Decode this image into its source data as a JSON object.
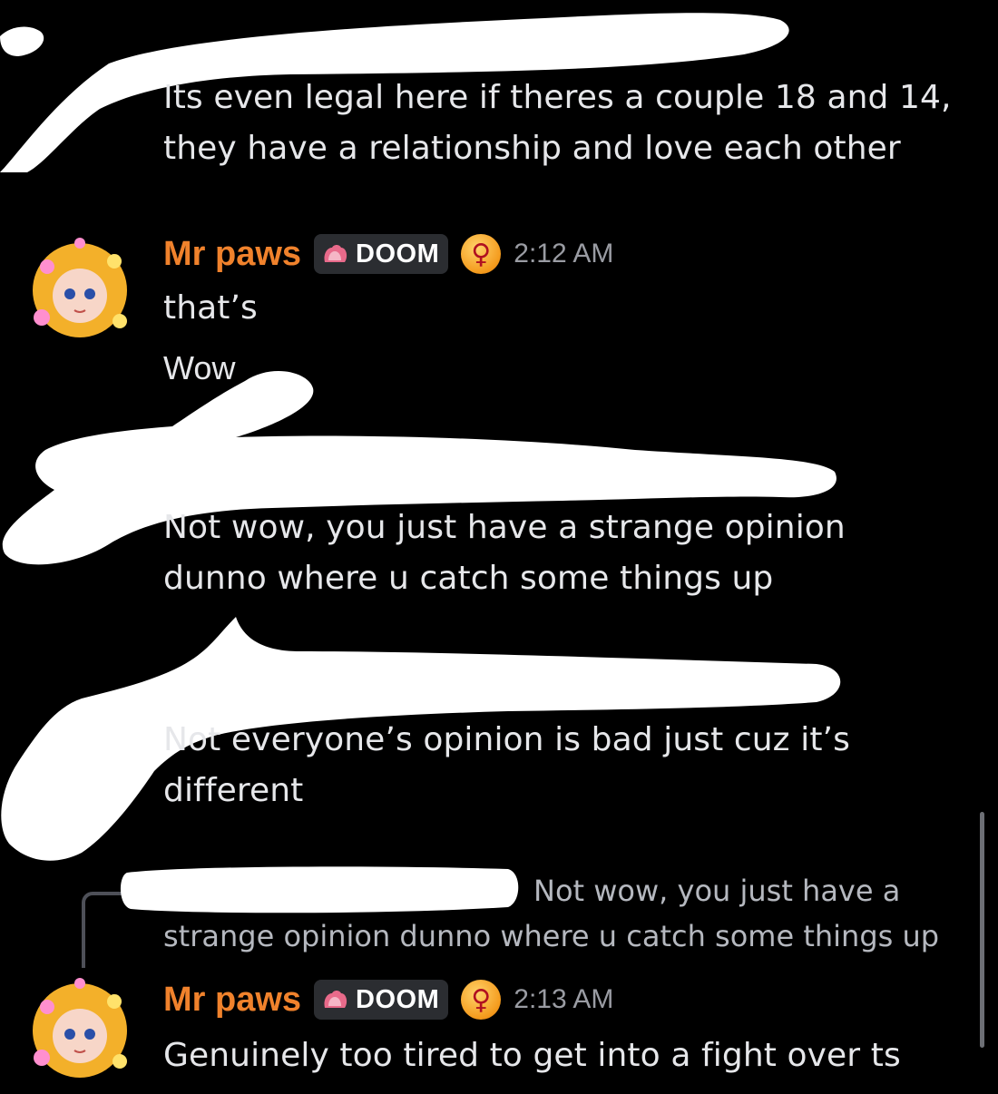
{
  "messages_top": {
    "lines": [
      "Its even legal here if theres a couple 18 and 14,",
      "they have a relationship and love each other"
    ]
  },
  "message_paws_1": {
    "username": "Mr paws",
    "tag": "DOOM",
    "time": "2:12 AM",
    "role_icon": "venus-symbol-icon",
    "lines": [
      "that’s",
      "Wow"
    ]
  },
  "message_3": {
    "lines": [
      "Not wow, you just have a strange opinion",
      "dunno where u catch some things up"
    ]
  },
  "message_4": {
    "lines": [
      "Not everyone’s opinion is bad just cuz it’s",
      "different"
    ]
  },
  "reply_preview": {
    "line1": "Not wow, you just have a",
    "line2": "strange opinion dunno where u catch some things up"
  },
  "message_paws_2": {
    "username": "Mr paws",
    "tag": "DOOM",
    "time": "2:13 AM",
    "role_icon": "venus-symbol-icon",
    "lines": [
      "Genuinely too tired to get into a fight over ts"
    ]
  },
  "colors": {
    "background": "#000000",
    "username": "#f0822c",
    "timestamp": "#9a9ca3",
    "tag_bg": "#2b2d31"
  }
}
